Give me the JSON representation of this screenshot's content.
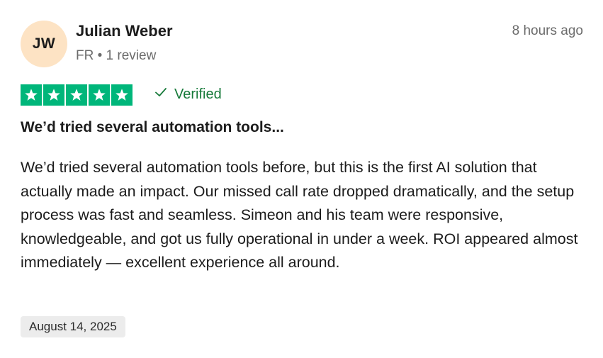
{
  "reviewer": {
    "initials": "JW",
    "name": "Julian Weber",
    "country": "FR",
    "separator": "•",
    "review_count": "1 review"
  },
  "time_ago": "8 hours ago",
  "rating": {
    "stars": 5,
    "max": 5,
    "star_color": "#00b67a",
    "icon": "star-icon"
  },
  "verified": {
    "label": "Verified",
    "icon": "checkmark-icon",
    "color": "#177a3a"
  },
  "review": {
    "title": "We’d tried several automation tools...",
    "body": "We’d tried several automation tools before, but this is the first AI solution that actually made an impact. Our missed call rate dropped dramatically, and the setup process was fast and seamless. Simeon and his team were responsive, knowledgeable, and got us fully operational in under a week. ROI appeared almost immediately — excellent experience all around."
  },
  "date_of_experience": "August 14, 2025",
  "colors": {
    "avatar_bg": "#fde3c4",
    "date_badge_bg": "#ececec"
  }
}
